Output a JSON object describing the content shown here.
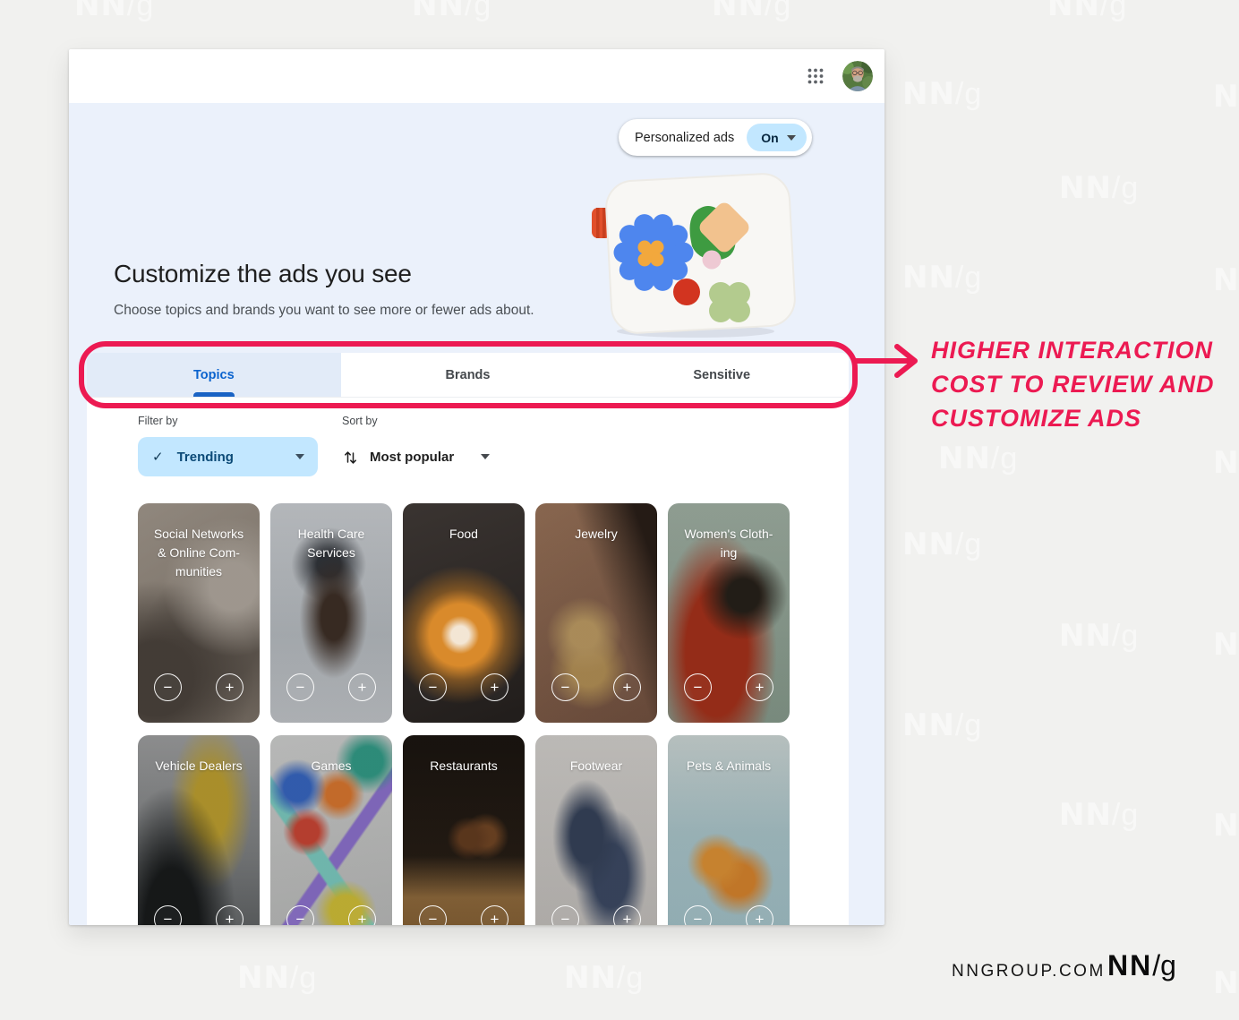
{
  "page": {
    "watermark": "NN/g",
    "background": "#f1f1ef",
    "footer": {
      "site": "NNGROUP.COM",
      "logo_nn": "NN",
      "logo_slash_g": "/g"
    }
  },
  "annotation": {
    "color": "#ec1a52",
    "lines": [
      "HIGHER INTERACTION",
      "COST TO REVIEW AND",
      "CUSTOMIZE ADS"
    ]
  },
  "app": {
    "personalized_ads": {
      "label": "Personalized ads",
      "value": "On"
    },
    "hero": {
      "title": "Customize the ads you see",
      "subtitle": "Choose topics and brands you want to see more or fewer ads about."
    },
    "tabs": [
      {
        "label": "Topics",
        "active": true
      },
      {
        "label": "Brands",
        "active": false
      },
      {
        "label": "Sensitive",
        "active": false
      }
    ],
    "filters": {
      "filter_by_label": "Filter by",
      "filter_value": "Trending",
      "check_icon": "✓",
      "sort_by_label": "Sort by",
      "sort_value": "Most popular"
    },
    "actions": {
      "remove": "−",
      "add": "+"
    },
    "topics": [
      {
        "label": "Social Networks\n& Online Com-\nmunities",
        "image": "social-networks"
      },
      {
        "label": "Health Care\nServices",
        "image": "health-care"
      },
      {
        "label": "Food",
        "image": "food"
      },
      {
        "label": "Jewelry",
        "image": "jewelry"
      },
      {
        "label": "Women's Cloth-\ning",
        "image": "womens-clothing"
      },
      {
        "label": "Vehicle Dealers",
        "image": "vehicle-dealers"
      },
      {
        "label": "Games",
        "image": "games"
      },
      {
        "label": "Restaurants",
        "image": "restaurants"
      },
      {
        "label": "Footwear",
        "image": "footwear"
      },
      {
        "label": "Pets & Animals",
        "image": "pets-animals"
      }
    ],
    "colors": {
      "chip_bg": "#c2e7ff",
      "tab_active_text": "#0b63ce",
      "hero_bg": "#ebf1fb"
    }
  }
}
